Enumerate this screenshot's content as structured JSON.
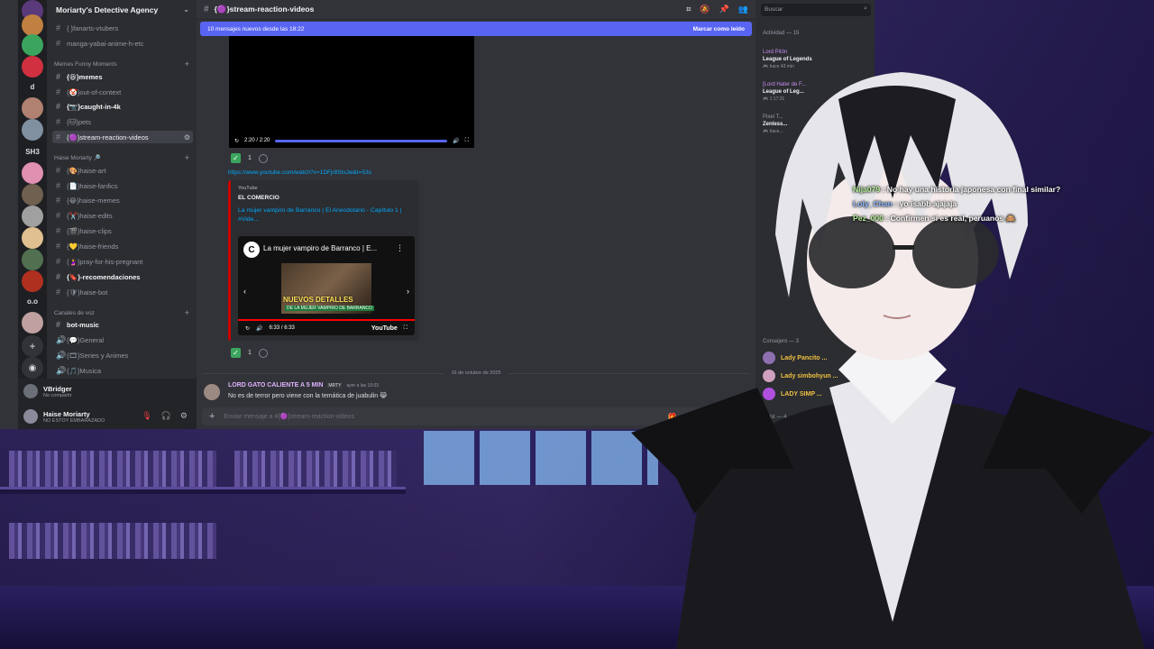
{
  "server": {
    "name": "Moriarty's Detective Agency",
    "rail_labels": [
      "d",
      "SH3",
      "o.o"
    ]
  },
  "channels": {
    "top_items": [
      {
        "label": "{ }fanarts-vtubers"
      },
      {
        "label": "manga-yabai-anime-h-etc"
      }
    ],
    "category_memes": "Memes Funny Moments",
    "memes_items": [
      {
        "label": "{😆}memes",
        "bold": true
      },
      {
        "label": "{🤡}out-of-context"
      },
      {
        "label": "{📷}caught-in-4k",
        "bold": true
      },
      {
        "label": "{🐱}pets"
      },
      {
        "label": "{🟣}stream-reaction-videos",
        "selected": true
      }
    ],
    "category_haise": "Haise Moriarty 🔎",
    "haise_items": [
      {
        "label": "{🎨}haise-art"
      },
      {
        "label": "{📄}haise-fanfics"
      },
      {
        "label": "{😂}haise-memes"
      },
      {
        "label": "{✂️}haise-edits"
      },
      {
        "label": "{🎬}haise-clips"
      },
      {
        "label": "{💛}haise-friends"
      },
      {
        "label": "{🤰}pray-for-his-pregnant"
      },
      {
        "label": "{🔖}-recomendaciones",
        "bold": true
      },
      {
        "label": "{🛡}haise-bot"
      }
    ],
    "category_voice": "Canales de voz",
    "voice_items": [
      {
        "label": "bot-music",
        "bold": true
      },
      {
        "label": "{💬}General"
      },
      {
        "label": "{🎞}Series y Animes"
      },
      {
        "label": "{🎵}Musica"
      }
    ]
  },
  "user_panel": {
    "status_name": "VBridger",
    "status_sub": "No compartir",
    "username": "Haise Moriarty",
    "user_status": "NO ESTOY EMBARAZADO"
  },
  "chat": {
    "channel_name": "{🟣}stream-reaction-videos",
    "new_messages": "10 mensajes nuevos desde las 18:22",
    "mark_read": "Marcar como leído",
    "video_time": "2:20 / 2:20",
    "reaction_count": "1",
    "link": "https://www.youtube.com/watch?v=1DFjr8SIsJw&t=53s",
    "embed": {
      "provider": "YouTube",
      "author": "EL COMERCIO",
      "title": "La mujer vampiro de Barranco | El Anecdotario - Capítulo 1 | #Vide...",
      "player_title": "La mujer vampiro de Barranco | E...",
      "caption_big": "NUEVOS DETALLES",
      "caption_small": "DE LA MUJER VAMPIRO DE BARRANCO",
      "player_time": "6:33 / 6:33",
      "player_brand": "YouTube"
    },
    "date_divider": "16 de octubre de 2025",
    "message": {
      "author": "LORD GATO CALIENTE A 5 MIN",
      "tag": "MRTY",
      "time": "ayer a las 10:03",
      "text": "No es de terror pero viene con la temática de juabulin 😹"
    },
    "composer_placeholder": "Enviar mensaje a #{🟣}stream-reaction-videos"
  },
  "members": {
    "search_placeholder": "Buscar",
    "activity_header": "Actividad — 15",
    "activities": [
      {
        "who": "Lord Pitón",
        "game": "League of Legends",
        "meta": "🎮 hace 43 min"
      },
      {
        "who": "[Lord Hater de F...",
        "game": "League of Leg...",
        "meta": "🎮 1:17:31"
      },
      {
        "who": "Pixel T...",
        "game": "Zenless...",
        "meta": "🎮 hace..."
      }
    ],
    "consejero_header": "Consejero — 3",
    "consejeros": [
      "Lady Pancito ...",
      "Lady simbohyun ...",
      "LADY SIMP ..."
    ],
    "artist_header": "Artist — 4"
  },
  "stream_chat": [
    {
      "user": "Nija079",
      "text": ": No hay una historia japonesa con final similar?",
      "color": "#b6f09a"
    },
    {
      "user": "Loly_Chan",
      "text": ": yo isabb ajajaja",
      "color": "#8fb8ff"
    },
    {
      "user": "Pez_000",
      "text": ": Confirmen si es real, peruanos 🙈",
      "color": "#b6f09a"
    }
  ]
}
